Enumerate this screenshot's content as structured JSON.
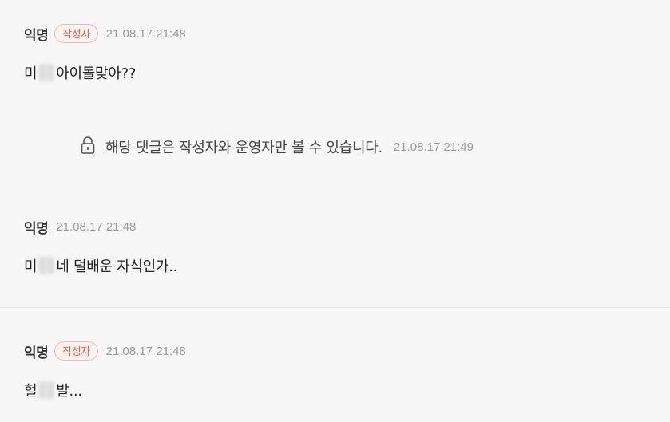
{
  "comments": [
    {
      "author": "익명",
      "badge": "작성자",
      "time": "21.08.17 21:48",
      "text_before": "미",
      "text_after": "아이돌맞아??"
    },
    {
      "author": "익명",
      "time": "21.08.17 21:48",
      "text_before": "미",
      "text_after": "네 덜배운 자식인가.."
    },
    {
      "author": "익명",
      "badge": "작성자",
      "time": "21.08.17 21:48",
      "text_before": "헐",
      "text_after": "발..."
    }
  ],
  "private_reply": {
    "icon": "lock-icon",
    "text": "해당 댓글은 작성자와 운영자만 볼 수 있습니다.",
    "time": "21.08.17 21:49"
  }
}
